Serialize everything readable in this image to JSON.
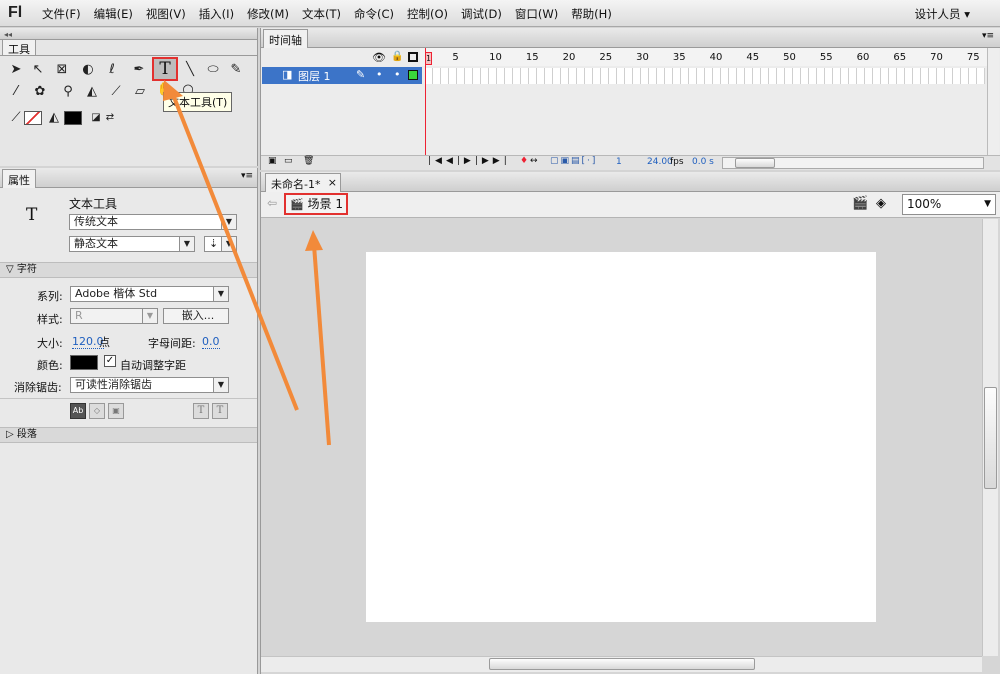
{
  "app": {
    "logo": "Fl"
  },
  "menu": [
    "文件(F)",
    "编辑(E)",
    "视图(V)",
    "插入(I)",
    "修改(M)",
    "文本(T)",
    "命令(C)",
    "控制(O)",
    "调试(D)",
    "窗口(W)",
    "帮助(H)"
  ],
  "workspace": "设计人员 ▾",
  "tools": {
    "title": "工具",
    "tooltip": "文本工具(T)",
    "text_tool_glyph": "T"
  },
  "timeline": {
    "title": "时间轴",
    "ruler": [
      "1",
      "5",
      "10",
      "15",
      "20",
      "25",
      "30",
      "35",
      "40",
      "45",
      "50",
      "55",
      "60",
      "65",
      "70",
      "75"
    ],
    "layer": "图层 1",
    "frame": "1",
    "fps": "24.00",
    "fps_unit": "fps",
    "time": "0.0 s"
  },
  "properties": {
    "title": "属性",
    "tool_name": "文本工具",
    "text_glyph": "T",
    "text_engine": "传统文本",
    "text_type": "静态文本",
    "section_char": "字符",
    "family_label": "系列:",
    "family_value": "Adobe 楷体 Std",
    "style_label": "样式:",
    "style_value": "R",
    "embed_button": "嵌入...",
    "size_label": "大小:",
    "size_value": "120.0",
    "size_unit": "点",
    "spacing_label": "字母间距:",
    "spacing_value": "0.0",
    "color_label": "颜色:",
    "auto_kern": "自动调整字距",
    "antialias_label": "消除锯齿:",
    "antialias_value": "可读性消除锯齿",
    "section_para": "段落"
  },
  "document": {
    "tab": "未命名-1*",
    "tab_close": "×",
    "scene": "场景 1",
    "zoom": "100%"
  },
  "colors": {
    "accent_red": "#e2312f",
    "arrow": "#f28a3a",
    "layer_blue": "#3c74c8"
  }
}
